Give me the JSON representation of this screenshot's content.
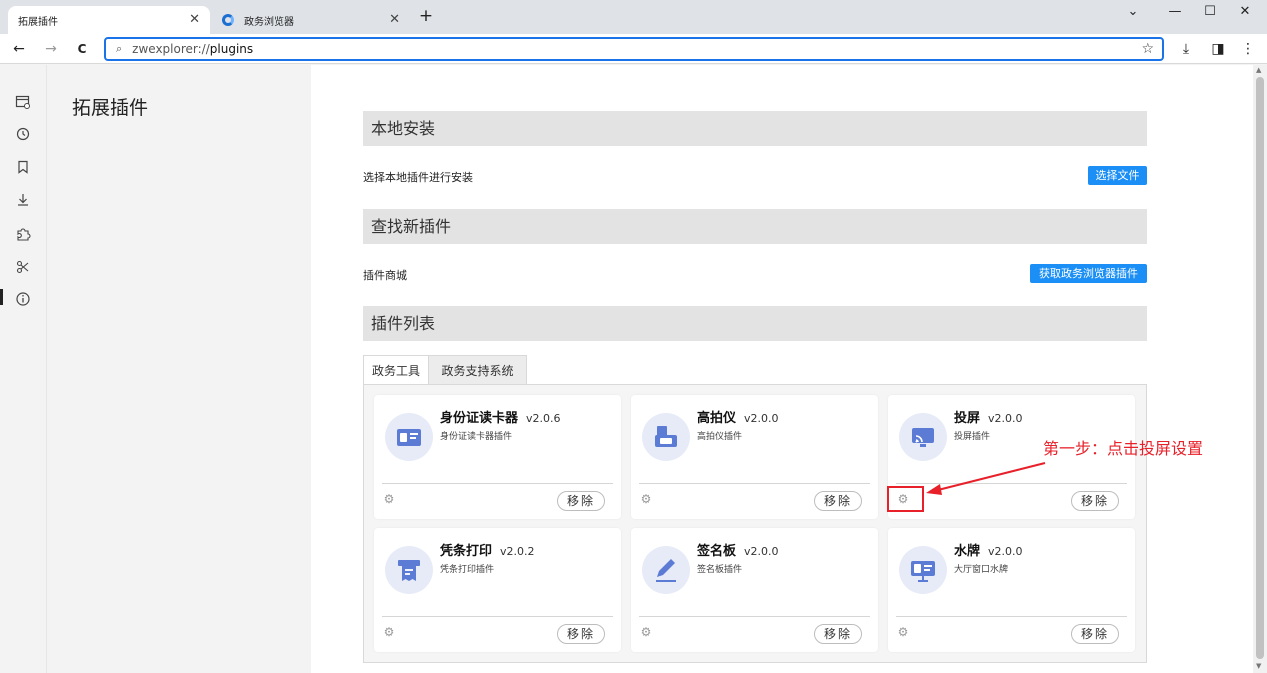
{
  "tabs": [
    {
      "label": "拓展插件",
      "active": true
    },
    {
      "label": "政务浏览器",
      "active": false
    }
  ],
  "window_controls": {
    "minimize": "—",
    "maximize": "☐",
    "close": "✕",
    "extra": "⌄"
  },
  "toolbar": {
    "back": "←",
    "forward": "→",
    "reload": "C",
    "url_scheme": "zwexplorer://",
    "url_host": "plugins",
    "star": "☆",
    "download": "⤓",
    "sidepanel": "◨",
    "menu": "⋮"
  },
  "sidebar_title": "拓展插件",
  "sections": {
    "local": {
      "title": "本地安装",
      "row_label": "选择本地插件进行安装",
      "button": "选择文件"
    },
    "find": {
      "title": "查找新插件",
      "row_label": "插件商城",
      "button": "获取政务浏览器插件"
    },
    "list": {
      "title": "插件列表"
    }
  },
  "plugin_tabs": [
    "政务工具",
    "政务支持系统"
  ],
  "plugins": [
    {
      "name": "身份证读卡器",
      "version": "v2.0.6",
      "desc": "身份证读卡器插件",
      "icon": "id-card-icon",
      "remove": "移除"
    },
    {
      "name": "高拍仪",
      "version": "v2.0.0",
      "desc": "高拍仪插件",
      "icon": "scanner-icon",
      "remove": "移除"
    },
    {
      "name": "投屏",
      "version": "v2.0.0",
      "desc": "投屏插件",
      "icon": "cast-icon",
      "remove": "移除"
    },
    {
      "name": "凭条打印",
      "version": "v2.0.2",
      "desc": "凭条打印插件",
      "icon": "receipt-printer-icon",
      "remove": "移除"
    },
    {
      "name": "签名板",
      "version": "v2.0.0",
      "desc": "签名板插件",
      "icon": "signature-pad-icon",
      "remove": "移除"
    },
    {
      "name": "水牌",
      "version": "v2.0.0",
      "desc": "大厅窗口水牌",
      "icon": "sign-board-icon",
      "remove": "移除"
    }
  ],
  "annotation": "第一步：点击投屏设置",
  "colors": {
    "accent": "#1b8ff5",
    "annotation": "#e8202a",
    "icon": "#5b7bd5"
  }
}
